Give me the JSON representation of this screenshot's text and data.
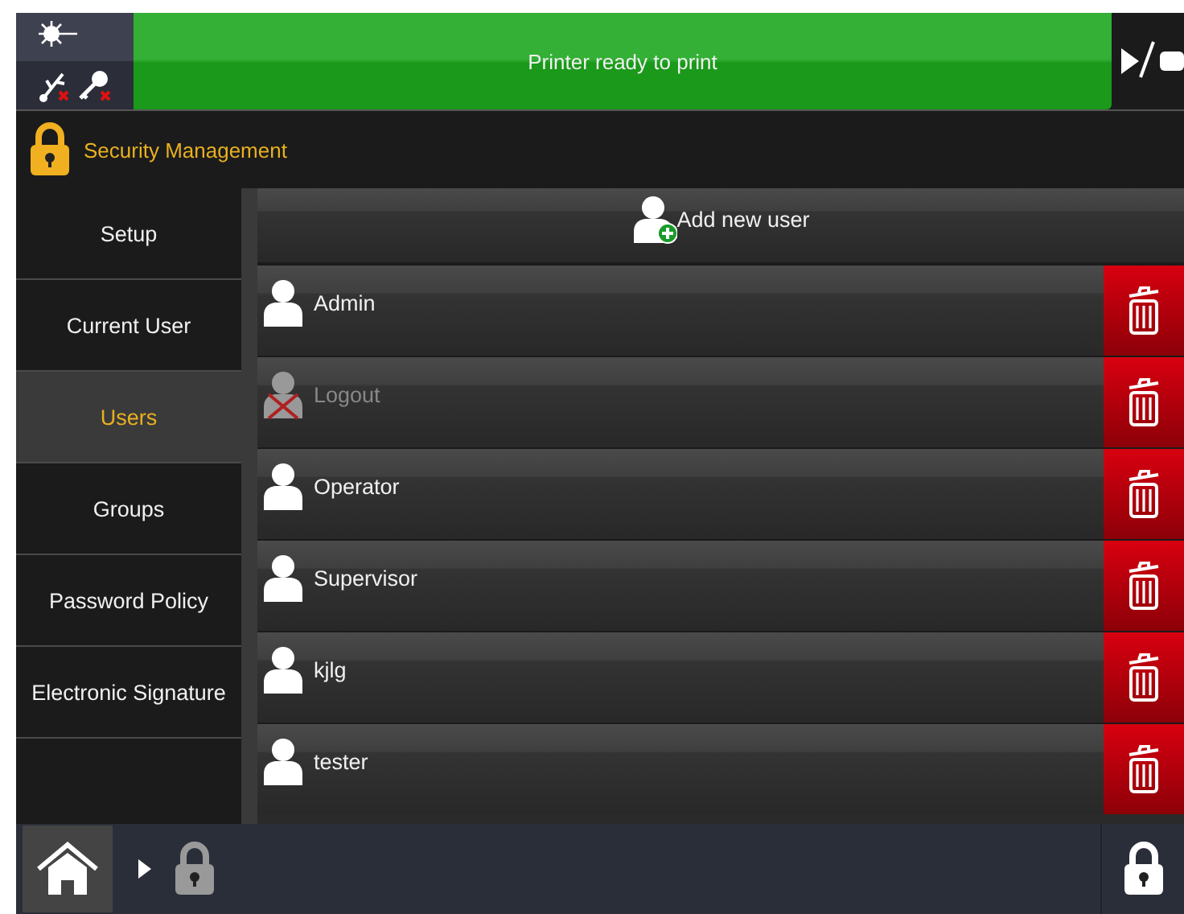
{
  "status_bar": {
    "message": "Printer ready to print"
  },
  "header": {
    "title": "Security Management"
  },
  "sidebar": {
    "items": [
      {
        "label": "Setup",
        "selected": false
      },
      {
        "label": "Current User",
        "selected": false
      },
      {
        "label": "Users",
        "selected": true
      },
      {
        "label": "Groups",
        "selected": false
      },
      {
        "label": "Password Policy",
        "selected": false
      },
      {
        "label": "Electronic Signature",
        "selected": false
      }
    ]
  },
  "add_button": {
    "label": "Add new user"
  },
  "users": [
    {
      "name": "Admin",
      "disabled": false
    },
    {
      "name": "Logout",
      "disabled": true
    },
    {
      "name": "Operator",
      "disabled": false
    },
    {
      "name": "Supervisor",
      "disabled": false
    },
    {
      "name": "kjlg",
      "disabled": false
    },
    {
      "name": "tester",
      "disabled": false
    }
  ]
}
